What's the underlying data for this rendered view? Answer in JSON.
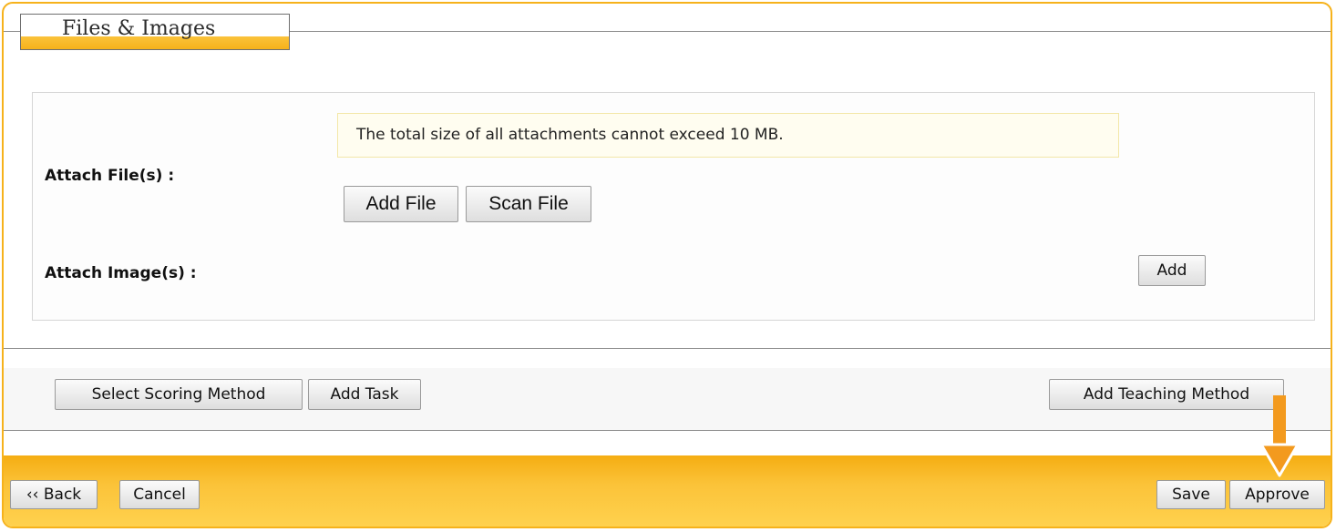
{
  "section": {
    "title": "Files & Images"
  },
  "attachments": {
    "notice": "The total size of all attachments cannot exceed 10 MB.",
    "attach_files_label": "Attach File(s) :",
    "add_file_label": "Add File",
    "scan_file_label": "Scan File",
    "attach_images_label": "Attach Image(s) :",
    "add_image_label": "Add"
  },
  "toolbar": {
    "select_scoring_method_label": "Select Scoring Method",
    "add_task_label": "Add Task",
    "add_teaching_method_label": "Add Teaching Method"
  },
  "footer": {
    "back_label": "‹‹ Back",
    "cancel_label": "Cancel",
    "save_label": "Save",
    "approve_label": "Approve"
  },
  "colors": {
    "accent": "#f6b21b",
    "arrow": "#f39a1e"
  },
  "icons": {
    "pointer": "down-arrow-icon"
  }
}
